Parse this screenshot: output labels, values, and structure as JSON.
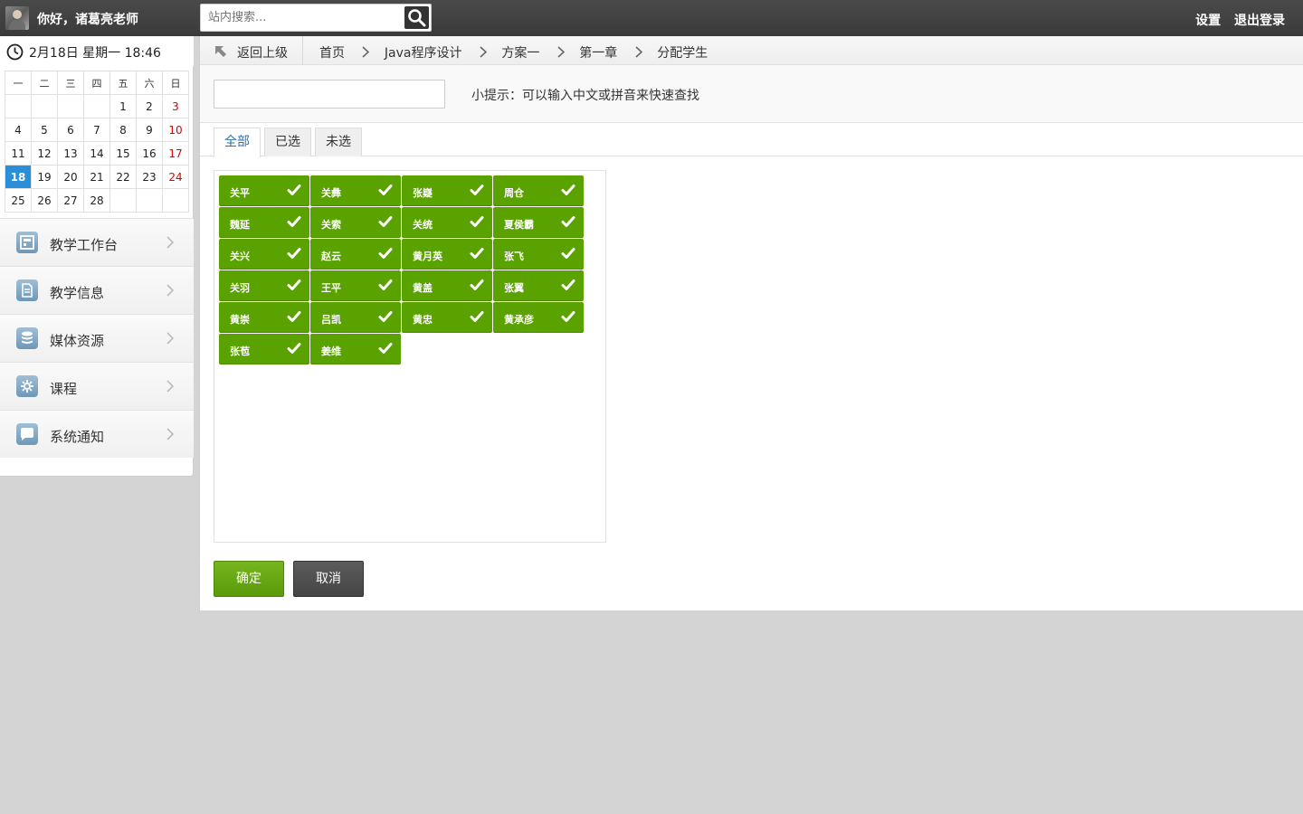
{
  "header": {
    "greeting": "你好，诸葛亮老师",
    "search_placeholder": "站内搜索...",
    "links": [
      "设置",
      "退出登录"
    ]
  },
  "sidebar": {
    "datetime": "2月18日 星期一 18:46",
    "calendar": {
      "weekdays": [
        "一",
        "二",
        "三",
        "四",
        "五",
        "六",
        "日"
      ],
      "weeks": [
        [
          "",
          "",
          "",
          "",
          "1",
          "2",
          "3"
        ],
        [
          "4",
          "5",
          "6",
          "7",
          "8",
          "9",
          "10"
        ],
        [
          "11",
          "12",
          "13",
          "14",
          "15",
          "16",
          "17"
        ],
        [
          "18",
          "19",
          "20",
          "21",
          "22",
          "23",
          "24"
        ],
        [
          "25",
          "26",
          "27",
          "28",
          "",
          "",
          ""
        ]
      ],
      "today": "18"
    },
    "menu": [
      {
        "label": "教学工作台",
        "icon": "dashboard-icon"
      },
      {
        "label": "教学信息",
        "icon": "document-icon"
      },
      {
        "label": "媒体资源",
        "icon": "database-icon"
      },
      {
        "label": "课程",
        "icon": "gear-icon"
      },
      {
        "label": "系统通知",
        "icon": "chat-bubble-icon"
      }
    ]
  },
  "breadcrumb": {
    "back": "返回上级",
    "items": [
      "首页",
      "Java程序设计",
      "方案一",
      "第一章",
      "分配学生"
    ]
  },
  "filter": {
    "value": "",
    "hint": "小提示：可以输入中文或拼音来快速查找"
  },
  "tabs": [
    {
      "label": "全部",
      "active": true
    },
    {
      "label": "已选",
      "active": false
    },
    {
      "label": "未选",
      "active": false
    }
  ],
  "students": [
    {
      "name": "关平",
      "selected": true
    },
    {
      "name": "关彝",
      "selected": true
    },
    {
      "name": "张嶷",
      "selected": true
    },
    {
      "name": "周仓",
      "selected": true
    },
    {
      "name": "魏延",
      "selected": true
    },
    {
      "name": "关索",
      "selected": true
    },
    {
      "name": "关统",
      "selected": true
    },
    {
      "name": "夏侯霸",
      "selected": true
    },
    {
      "name": "关兴",
      "selected": true
    },
    {
      "name": "赵云",
      "selected": true
    },
    {
      "name": "黄月英",
      "selected": true
    },
    {
      "name": "张飞",
      "selected": true
    },
    {
      "name": "关羽",
      "selected": true
    },
    {
      "name": "王平",
      "selected": true
    },
    {
      "name": "黄盖",
      "selected": true
    },
    {
      "name": "张翼",
      "selected": true
    },
    {
      "name": "黄崇",
      "selected": true
    },
    {
      "name": "吕凯",
      "selected": true
    },
    {
      "name": "黄忠",
      "selected": true
    },
    {
      "name": "黄承彦",
      "selected": true
    },
    {
      "name": "张苞",
      "selected": true
    },
    {
      "name": "姜维",
      "selected": true
    }
  ],
  "actions": {
    "confirm": "确定",
    "cancel": "取消"
  },
  "colors": {
    "selected_green": "#5aa200",
    "topbar": "#3f3f3f",
    "today_blue": "#2a8fd8",
    "sunday_red": "#dd0000"
  }
}
